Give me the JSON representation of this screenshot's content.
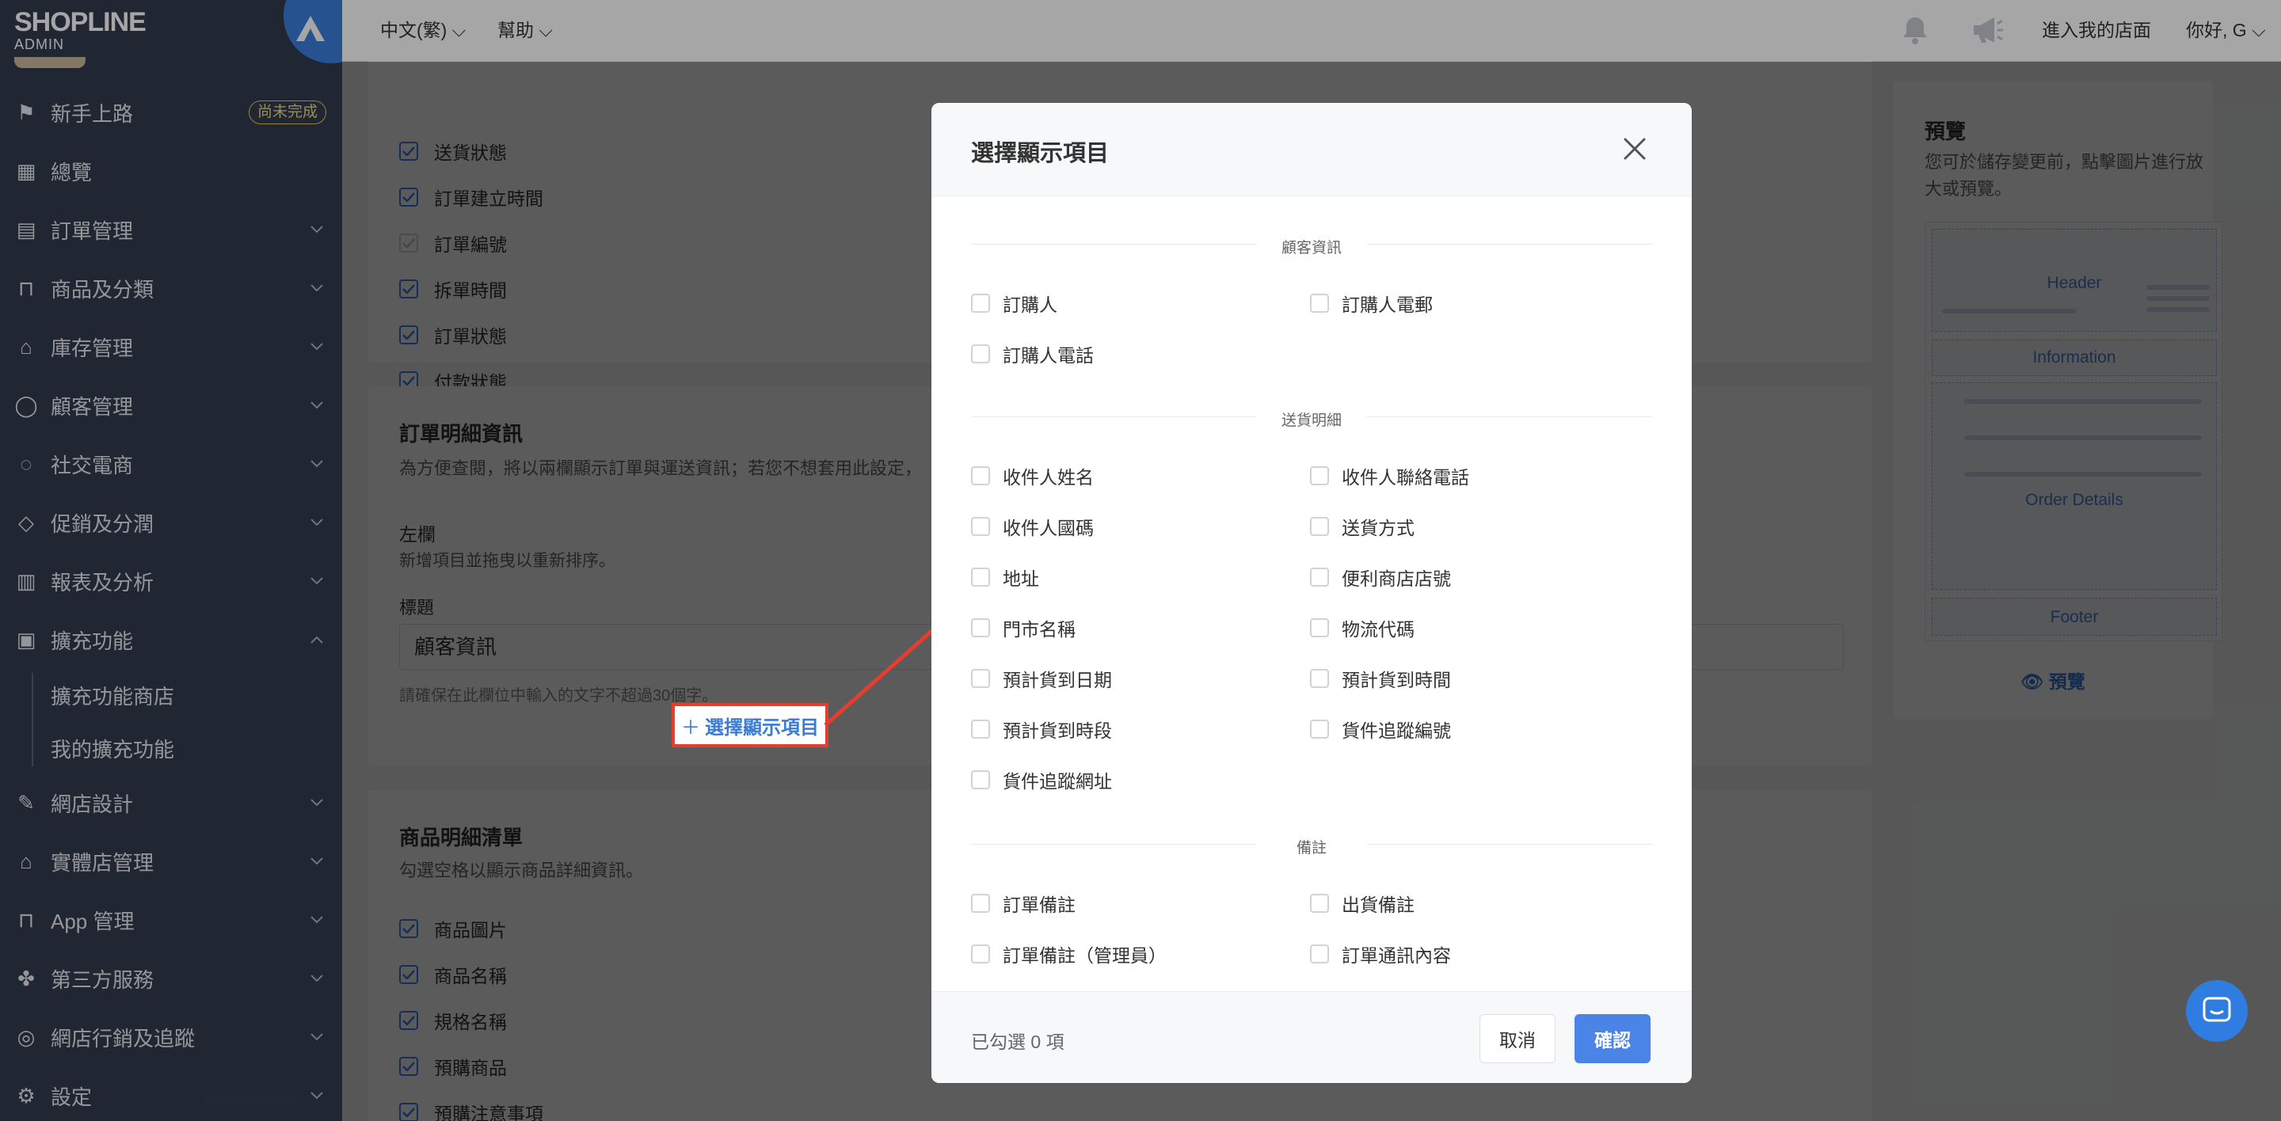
{
  "brand": {
    "name": "SHOPLINE",
    "sub": "ADMIN"
  },
  "sidebar": {
    "items": [
      {
        "label": "新手上路",
        "icon": "signpost-icon",
        "badge": "尚未完成"
      },
      {
        "label": "總覽",
        "icon": "dashboard-icon"
      },
      {
        "label": "訂單管理",
        "icon": "order-icon"
      },
      {
        "label": "商品及分類",
        "icon": "bag-icon"
      },
      {
        "label": "庫存管理",
        "icon": "warehouse-icon"
      },
      {
        "label": "顧客管理",
        "icon": "user-icon"
      },
      {
        "label": "社交電商",
        "icon": "chat-icon"
      },
      {
        "label": "促銷及分潤",
        "icon": "tag-icon"
      },
      {
        "label": "報表及分析",
        "icon": "chart-icon"
      },
      {
        "label": "擴充功能",
        "icon": "apps-icon",
        "expanded": true
      },
      {
        "label": "網店設計",
        "icon": "brush-icon"
      },
      {
        "label": "實體店管理",
        "icon": "store-icon"
      },
      {
        "label": "App 管理",
        "icon": "bag-icon"
      },
      {
        "label": "第三方服務",
        "icon": "puzzle-icon"
      },
      {
        "label": "網店行銷及追蹤",
        "icon": "target-icon"
      },
      {
        "label": "設定",
        "icon": "gear-icon"
      }
    ],
    "sub_items": [
      "擴充功能商店",
      "我的擴充功能"
    ]
  },
  "topbar": {
    "language": "中文(繁)",
    "help": "幫助",
    "visit_store": "進入我的店面",
    "greeting": "你好, G"
  },
  "page": {
    "status_checks": [
      "送貨狀態",
      "訂單建立時間",
      "訂單編號",
      "拆單時間",
      "訂單狀態",
      "付款狀態"
    ],
    "order_detail": {
      "title": "訂單明細資訊",
      "desc": "為方便查閱，將以兩欄顯示訂單與運送資訊；若您不想套用此設定，",
      "left_col": "左欄",
      "left_hint": "新增項目並拖曳以重新排序。",
      "field_label": "標題",
      "field_value": "顧客資訊",
      "field_hint": "請確保在此欄位中輸入的文字不超過30個字。",
      "select_button": "選擇顯示項目"
    },
    "product_list": {
      "title": "商品明細清單",
      "desc": "勾選空格以顯示商品詳細資訊。",
      "checks": [
        "商品圖片",
        "商品名稱",
        "規格名稱",
        "預購商品",
        "預購注意事項"
      ]
    },
    "preview": {
      "title": "預覽",
      "desc_line1": "您可於儲存變更前，點擊圖片進行放",
      "desc_line2": "大或預覽。",
      "thumb_labels": [
        "Header",
        "Information",
        "Order Details",
        "Footer"
      ],
      "button": "預覽"
    }
  },
  "modal": {
    "title": "選擇顯示項目",
    "sections": [
      {
        "title": "顧客資訊",
        "options": [
          "訂購人",
          "訂購人電郵",
          "訂購人電話"
        ]
      },
      {
        "title": "送貨明細",
        "options": [
          "收件人姓名",
          "收件人聯絡電話",
          "收件人國碼",
          "送貨方式",
          "地址",
          "便利商店店號",
          "門市名稱",
          "物流代碼",
          "預計貨到日期",
          "預計貨到時間",
          "預計貨到時段",
          "貨件追蹤編號",
          "貨件追蹤網址"
        ]
      },
      {
        "title": "備註",
        "options": [
          "訂單備註",
          "出貨備註",
          "訂單備註（管理員）",
          "訂單通訊內容"
        ]
      }
    ],
    "selected_count": "已勾選 0 項",
    "cancel": "取消",
    "confirm": "確認"
  },
  "colors": {
    "sidebar_bg": "#323c4f",
    "accent": "#4a84e6",
    "highlight": "#e53e2e"
  }
}
